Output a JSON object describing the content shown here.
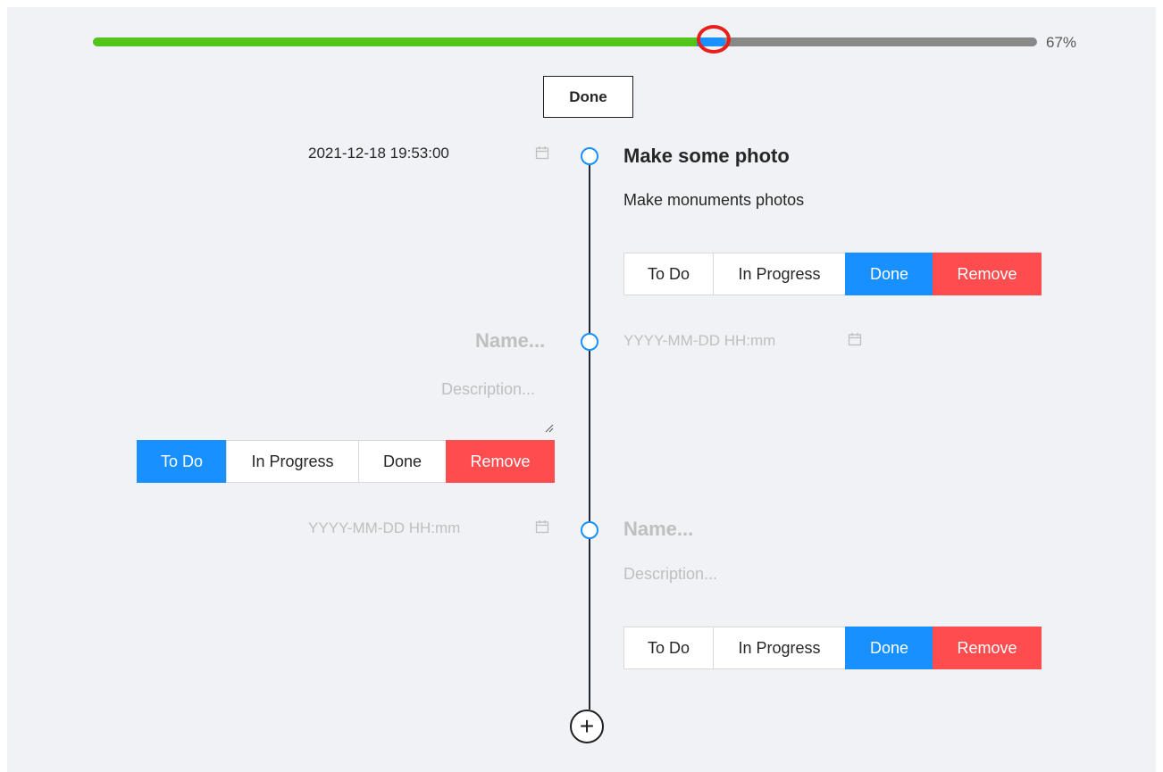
{
  "progress": {
    "percent_label": "67%",
    "done_fraction": 0.64,
    "current_fraction": 0.03,
    "colors": {
      "done": "#52c41a",
      "current": "#1890ff",
      "remaining": "#888888",
      "marker": "#e8201c"
    }
  },
  "filter": {
    "done_label": "Done"
  },
  "tasks": [
    {
      "date": "2021-12-18 19:53:00",
      "name": "Make some photo",
      "description": "Make monuments photos",
      "buttons": {
        "todo": "To Do",
        "in_progress": "In Progress",
        "done": "Done",
        "remove": "Remove"
      },
      "status": "Done"
    },
    {
      "date_placeholder": "YYYY-MM-DD HH:mm",
      "name_placeholder": "Name...",
      "description_placeholder": "Description...",
      "buttons": {
        "todo": "To Do",
        "in_progress": "In Progress",
        "done": "Done",
        "remove": "Remove"
      },
      "status": "To Do"
    },
    {
      "date_placeholder": "YYYY-MM-DD HH:mm",
      "name_placeholder": "Name...",
      "description_placeholder": "Description...",
      "buttons": {
        "todo": "To Do",
        "in_progress": "In Progress",
        "done": "Done",
        "remove": "Remove"
      },
      "status": "Done"
    }
  ],
  "icons": {
    "calendar": "calendar-icon",
    "add": "plus-circle-icon",
    "resize": "resize-handle-icon"
  },
  "add_symbol": "+"
}
